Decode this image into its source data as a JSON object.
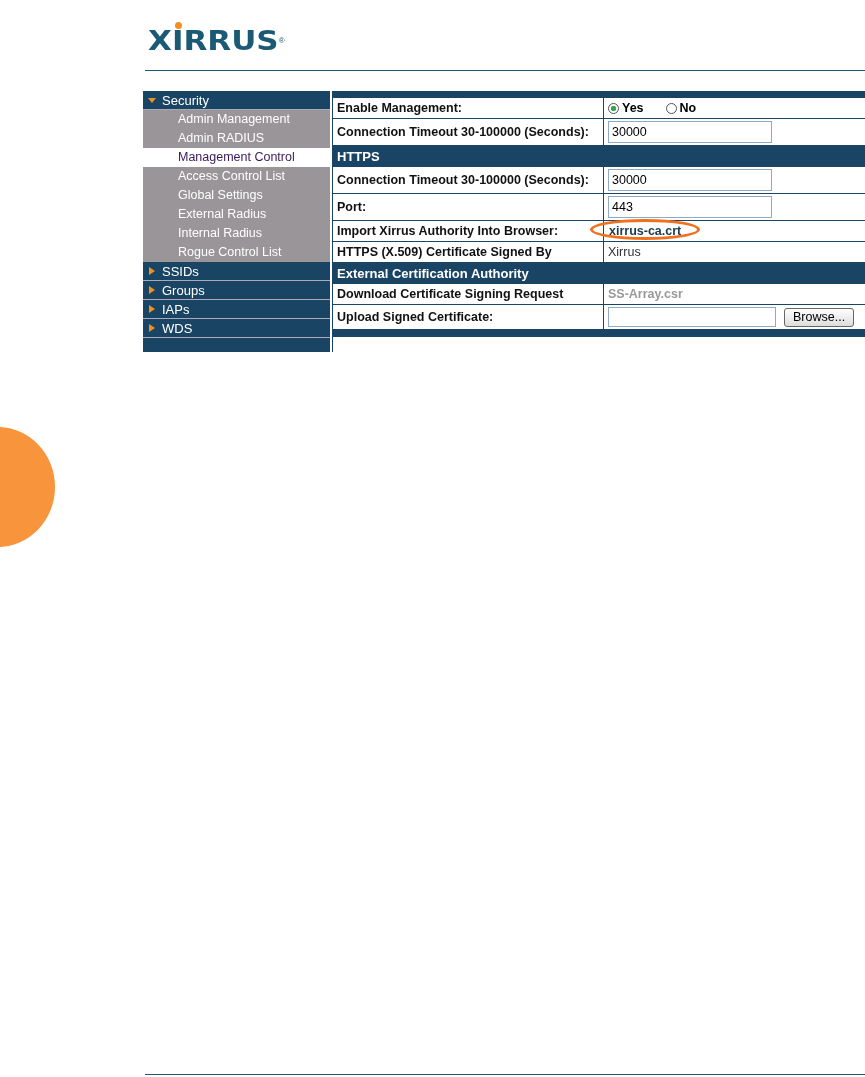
{
  "logo": {
    "text": "XIRRUS",
    "mark": "®"
  },
  "sidebar": {
    "items": [
      {
        "label": "Security",
        "expanded": true,
        "children": [
          {
            "label": "Admin Management",
            "selected": false
          },
          {
            "label": "Admin RADIUS",
            "selected": false
          },
          {
            "label": "Management Control",
            "selected": true
          },
          {
            "label": "Access Control List",
            "selected": false
          },
          {
            "label": "Global Settings",
            "selected": false
          },
          {
            "label": "External Radius",
            "selected": false
          },
          {
            "label": "Internal Radius",
            "selected": false
          },
          {
            "label": "Rogue Control List",
            "selected": false
          }
        ]
      },
      {
        "label": "SSIDs",
        "expanded": false
      },
      {
        "label": "Groups",
        "expanded": false
      },
      {
        "label": "IAPs",
        "expanded": false
      },
      {
        "label": "WDS",
        "expanded": false
      }
    ]
  },
  "form": {
    "rows": [
      {
        "kind": "band"
      },
      {
        "kind": "radio",
        "label": "Enable Management:",
        "options": [
          {
            "label": "Yes",
            "selected": true
          },
          {
            "label": "No",
            "selected": false
          }
        ]
      },
      {
        "kind": "input",
        "label": "Connection Timeout 30-100000 (Seconds):",
        "value": "30000"
      },
      {
        "kind": "header",
        "label": "HTTPS"
      },
      {
        "kind": "input",
        "label": "Connection Timeout 30-100000 (Seconds):",
        "value": "30000"
      },
      {
        "kind": "input",
        "label": "Port:",
        "value": "443"
      },
      {
        "kind": "link",
        "label": "Import Xirrus Authority Into Browser:",
        "value": "xirrus-ca.crt",
        "circled": true
      },
      {
        "kind": "text",
        "label": "HTTPS (X.509) Certificate Signed By",
        "value": "Xirrus"
      },
      {
        "kind": "header",
        "label": "External Certification Authority"
      },
      {
        "kind": "muted",
        "label": "Download Certificate Signing Request",
        "value": "SS-Array.csr"
      },
      {
        "kind": "file",
        "label": "Upload Signed Certificate:",
        "button": "Browse..."
      },
      {
        "kind": "band"
      }
    ]
  }
}
